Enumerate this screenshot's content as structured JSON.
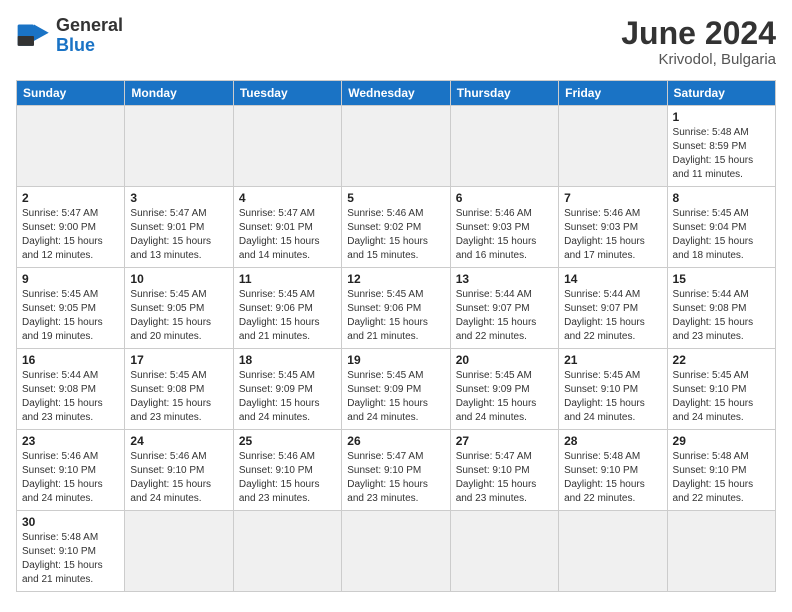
{
  "header": {
    "logo_general": "General",
    "logo_blue": "Blue",
    "title": "June 2024",
    "subtitle": "Krivodol, Bulgaria"
  },
  "weekdays": [
    "Sunday",
    "Monday",
    "Tuesday",
    "Wednesday",
    "Thursday",
    "Friday",
    "Saturday"
  ],
  "weeks": [
    [
      {
        "day": "",
        "info": "",
        "empty": true
      },
      {
        "day": "",
        "info": "",
        "empty": true
      },
      {
        "day": "",
        "info": "",
        "empty": true
      },
      {
        "day": "",
        "info": "",
        "empty": true
      },
      {
        "day": "",
        "info": "",
        "empty": true
      },
      {
        "day": "",
        "info": "",
        "empty": true
      },
      {
        "day": "1",
        "info": "Sunrise: 5:48 AM\nSunset: 8:59 PM\nDaylight: 15 hours\nand 11 minutes.",
        "empty": false
      }
    ],
    [
      {
        "day": "2",
        "info": "Sunrise: 5:47 AM\nSunset: 9:00 PM\nDaylight: 15 hours\nand 12 minutes.",
        "empty": false
      },
      {
        "day": "3",
        "info": "Sunrise: 5:47 AM\nSunset: 9:01 PM\nDaylight: 15 hours\nand 13 minutes.",
        "empty": false
      },
      {
        "day": "4",
        "info": "Sunrise: 5:47 AM\nSunset: 9:01 PM\nDaylight: 15 hours\nand 14 minutes.",
        "empty": false
      },
      {
        "day": "5",
        "info": "Sunrise: 5:46 AM\nSunset: 9:02 PM\nDaylight: 15 hours\nand 15 minutes.",
        "empty": false
      },
      {
        "day": "6",
        "info": "Sunrise: 5:46 AM\nSunset: 9:03 PM\nDaylight: 15 hours\nand 16 minutes.",
        "empty": false
      },
      {
        "day": "7",
        "info": "Sunrise: 5:46 AM\nSunset: 9:03 PM\nDaylight: 15 hours\nand 17 minutes.",
        "empty": false
      },
      {
        "day": "8",
        "info": "Sunrise: 5:45 AM\nSunset: 9:04 PM\nDaylight: 15 hours\nand 18 minutes.",
        "empty": false
      }
    ],
    [
      {
        "day": "9",
        "info": "Sunrise: 5:45 AM\nSunset: 9:05 PM\nDaylight: 15 hours\nand 19 minutes.",
        "empty": false
      },
      {
        "day": "10",
        "info": "Sunrise: 5:45 AM\nSunset: 9:05 PM\nDaylight: 15 hours\nand 20 minutes.",
        "empty": false
      },
      {
        "day": "11",
        "info": "Sunrise: 5:45 AM\nSunset: 9:06 PM\nDaylight: 15 hours\nand 21 minutes.",
        "empty": false
      },
      {
        "day": "12",
        "info": "Sunrise: 5:45 AM\nSunset: 9:06 PM\nDaylight: 15 hours\nand 21 minutes.",
        "empty": false
      },
      {
        "day": "13",
        "info": "Sunrise: 5:44 AM\nSunset: 9:07 PM\nDaylight: 15 hours\nand 22 minutes.",
        "empty": false
      },
      {
        "day": "14",
        "info": "Sunrise: 5:44 AM\nSunset: 9:07 PM\nDaylight: 15 hours\nand 22 minutes.",
        "empty": false
      },
      {
        "day": "15",
        "info": "Sunrise: 5:44 AM\nSunset: 9:08 PM\nDaylight: 15 hours\nand 23 minutes.",
        "empty": false
      }
    ],
    [
      {
        "day": "16",
        "info": "Sunrise: 5:44 AM\nSunset: 9:08 PM\nDaylight: 15 hours\nand 23 minutes.",
        "empty": false
      },
      {
        "day": "17",
        "info": "Sunrise: 5:45 AM\nSunset: 9:08 PM\nDaylight: 15 hours\nand 23 minutes.",
        "empty": false
      },
      {
        "day": "18",
        "info": "Sunrise: 5:45 AM\nSunset: 9:09 PM\nDaylight: 15 hours\nand 24 minutes.",
        "empty": false
      },
      {
        "day": "19",
        "info": "Sunrise: 5:45 AM\nSunset: 9:09 PM\nDaylight: 15 hours\nand 24 minutes.",
        "empty": false
      },
      {
        "day": "20",
        "info": "Sunrise: 5:45 AM\nSunset: 9:09 PM\nDaylight: 15 hours\nand 24 minutes.",
        "empty": false
      },
      {
        "day": "21",
        "info": "Sunrise: 5:45 AM\nSunset: 9:10 PM\nDaylight: 15 hours\nand 24 minutes.",
        "empty": false
      },
      {
        "day": "22",
        "info": "Sunrise: 5:45 AM\nSunset: 9:10 PM\nDaylight: 15 hours\nand 24 minutes.",
        "empty": false
      }
    ],
    [
      {
        "day": "23",
        "info": "Sunrise: 5:46 AM\nSunset: 9:10 PM\nDaylight: 15 hours\nand 24 minutes.",
        "empty": false
      },
      {
        "day": "24",
        "info": "Sunrise: 5:46 AM\nSunset: 9:10 PM\nDaylight: 15 hours\nand 24 minutes.",
        "empty": false
      },
      {
        "day": "25",
        "info": "Sunrise: 5:46 AM\nSunset: 9:10 PM\nDaylight: 15 hours\nand 23 minutes.",
        "empty": false
      },
      {
        "day": "26",
        "info": "Sunrise: 5:47 AM\nSunset: 9:10 PM\nDaylight: 15 hours\nand 23 minutes.",
        "empty": false
      },
      {
        "day": "27",
        "info": "Sunrise: 5:47 AM\nSunset: 9:10 PM\nDaylight: 15 hours\nand 23 minutes.",
        "empty": false
      },
      {
        "day": "28",
        "info": "Sunrise: 5:48 AM\nSunset: 9:10 PM\nDaylight: 15 hours\nand 22 minutes.",
        "empty": false
      },
      {
        "day": "29",
        "info": "Sunrise: 5:48 AM\nSunset: 9:10 PM\nDaylight: 15 hours\nand 22 minutes.",
        "empty": false
      }
    ],
    [
      {
        "day": "30",
        "info": "Sunrise: 5:48 AM\nSunset: 9:10 PM\nDaylight: 15 hours\nand 21 minutes.",
        "empty": false
      },
      {
        "day": "",
        "info": "",
        "empty": true
      },
      {
        "day": "",
        "info": "",
        "empty": true
      },
      {
        "day": "",
        "info": "",
        "empty": true
      },
      {
        "day": "",
        "info": "",
        "empty": true
      },
      {
        "day": "",
        "info": "",
        "empty": true
      },
      {
        "day": "",
        "info": "",
        "empty": true
      }
    ]
  ]
}
